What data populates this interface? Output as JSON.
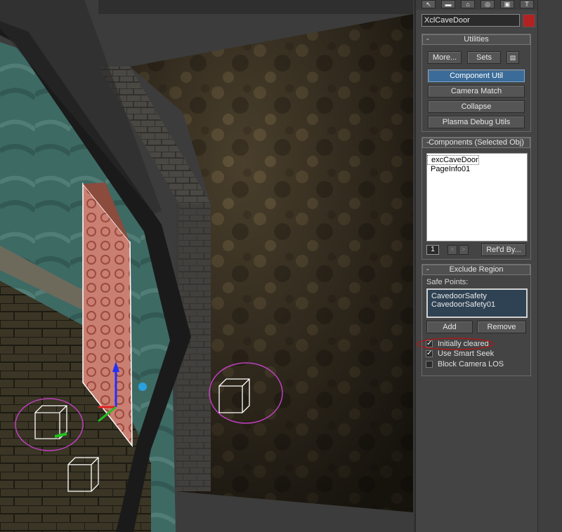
{
  "panel": {
    "object_name": "XclCaveDoor",
    "object_color": "#b22222",
    "top_icons": [
      "select-icon",
      "display-icon",
      "hierarchy-icon",
      "motion-icon",
      "utilities-icon",
      "hammer-icon"
    ]
  },
  "utilities": {
    "title": "Utilities",
    "more_label": "More...",
    "sets_label": "Sets",
    "buttons": [
      "Component Util",
      "Camera Match",
      "Collapse",
      "Plasma Debug Utils"
    ],
    "active_button": "Component Util"
  },
  "components": {
    "title": "Components (Selected Obj)",
    "items": [
      "excCaveDoor",
      "PageInfo01"
    ],
    "selected_item": "excCaveDoor",
    "spinner_value": "1",
    "refd_by_label": "Ref'd By..."
  },
  "exclude_region": {
    "title": "Exclude Region",
    "safe_points_label": "Safe Points:",
    "safe_points": [
      "CavedoorSafety",
      "CavedoorSafety01"
    ],
    "add_label": "Add",
    "remove_label": "Remove",
    "checkboxes": [
      {
        "label": "Initially cleared",
        "checked": true
      },
      {
        "label": "Use Smart Seek",
        "checked": true
      },
      {
        "label": "Block Camera LOS",
        "checked": false
      }
    ]
  },
  "annotation_color": "#c040c0"
}
